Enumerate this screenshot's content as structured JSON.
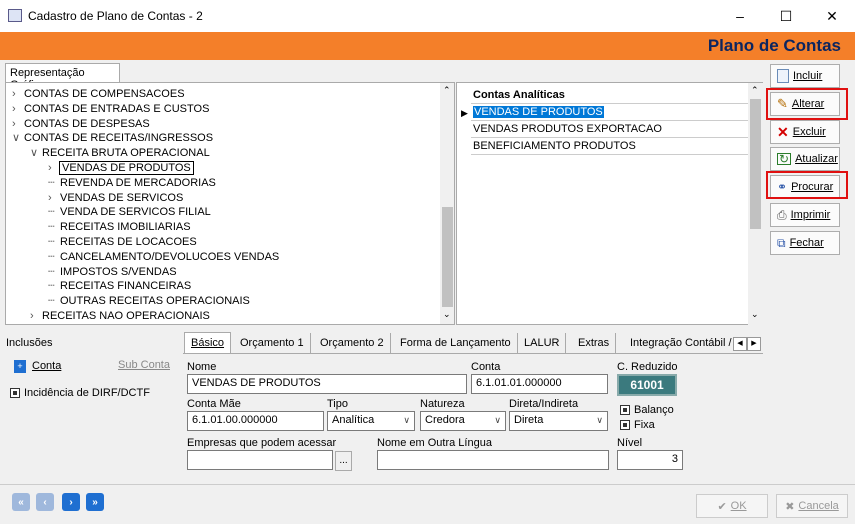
{
  "window": {
    "title": "Cadastro de Plano de Contas - 2",
    "minimize": "–",
    "maximize": "☐",
    "close": "✕"
  },
  "header": {
    "title": "Plano de Contas"
  },
  "tree_tab": "Representação Gráfica",
  "tree": [
    {
      "label": "CONTAS DE COMPENSACOES",
      "level": 0,
      "exp": ">"
    },
    {
      "label": "CONTAS DE ENTRADAS E CUSTOS",
      "level": 0,
      "exp": ">"
    },
    {
      "label": "CONTAS DE DESPESAS",
      "level": 0,
      "exp": ">"
    },
    {
      "label": "CONTAS DE RECEITAS/INGRESSOS",
      "level": 0,
      "exp": "v"
    },
    {
      "label": "RECEITA BRUTA OPERACIONAL",
      "level": 1,
      "exp": "v"
    },
    {
      "label": "VENDAS DE PRODUTOS",
      "level": 2,
      "exp": ">"
    },
    {
      "label": "REVENDA DE MERCADORIAS",
      "level": 2,
      "exp": ""
    },
    {
      "label": "VENDAS DE SERVICOS",
      "level": 2,
      "exp": ">"
    },
    {
      "label": "VENDA DE SERVICOS FILIAL",
      "level": 2,
      "exp": ""
    },
    {
      "label": "RECEITAS IMOBILIARIAS",
      "level": 2,
      "exp": ""
    },
    {
      "label": "RECEITAS DE LOCACOES",
      "level": 2,
      "exp": ""
    },
    {
      "label": "CANCELAMENTO/DEVOLUCOES VENDAS",
      "level": 2,
      "exp": ""
    },
    {
      "label": "IMPOSTOS S/VENDAS",
      "level": 2,
      "exp": ""
    },
    {
      "label": "RECEITAS FINANCEIRAS",
      "level": 2,
      "exp": ""
    },
    {
      "label": "OUTRAS RECEITAS OPERACIONAIS",
      "level": 2,
      "exp": ""
    },
    {
      "label": "RECEITAS NAO OPERACIONAIS",
      "level": 1,
      "exp": ">"
    }
  ],
  "contas": {
    "header": "Contas Analíticas",
    "rows": [
      "VENDAS DE PRODUTOS",
      "VENDAS PRODUTOS EXPORTACAO",
      "BENEFICIAMENTO PRODUTOS"
    ]
  },
  "side_buttons": [
    "Incluir",
    "Alterar",
    "Excluir",
    "Atualizar",
    "Procurar",
    "Imprimir",
    "Fechar"
  ],
  "inclusoes": {
    "title": "Inclusões",
    "conta": "Conta",
    "subconta": "Sub Conta",
    "dirf": "Incidência de DIRF/DCTF"
  },
  "tabs": [
    "Básico",
    "Orçamento 1",
    "Orçamento 2",
    "Forma de Lançamento",
    "LALUR",
    "Extras",
    "Integração Contábil /"
  ],
  "form": {
    "nome_label": "Nome",
    "nome": "VENDAS DE PRODUTOS",
    "conta_label": "Conta",
    "conta": "6.1.01.01.000000",
    "creduzido_label": "C. Reduzido",
    "creduzido": "61001",
    "contamae_label": "Conta Mãe",
    "contamae": "6.1.01.00.000000",
    "tipo_label": "Tipo",
    "tipo": "Analítica",
    "natureza_label": "Natureza",
    "natureza": "Credora",
    "direta_label": "Direta/Indireta",
    "direta": "Direta",
    "balanco": "Balanço",
    "fixa": "Fixa",
    "empresas_label": "Empresas que podem acessar",
    "empresas_btn": "...",
    "outra_label": "Nome em Outra Língua",
    "nivel_label": "Nível",
    "nivel": "3"
  },
  "footer": {
    "ok": "OK",
    "cancel": "Cancela"
  },
  "colors": {
    "accent": "#f47f29",
    "header_text": "#0b2560",
    "highlight": "#0078d7",
    "creduzido_bg": "#3b7a7e",
    "redbox": "#e01010",
    "nav_blue": "#1f6fd1"
  }
}
